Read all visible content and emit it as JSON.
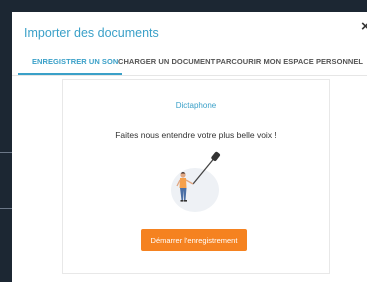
{
  "dialog": {
    "title": "Importer des documents",
    "close_icon": "close-icon"
  },
  "tabs": [
    {
      "label": "ENREGISTRER UN SON",
      "active": true
    },
    {
      "label": "CHARGER UN DOCUMENT",
      "active": false
    },
    {
      "label": "PARCOURIR MON ESPACE PERSONNEL",
      "active": false
    }
  ],
  "recorder": {
    "title": "Dictaphone",
    "message": "Faites nous entendre votre plus belle voix !",
    "illustration": "person-with-boom-microphone",
    "button_label": "Démarrer l'enregistrement"
  },
  "colors": {
    "accent": "#3aa0c8",
    "button": "#f58220",
    "backdrop": "#1c2733"
  }
}
